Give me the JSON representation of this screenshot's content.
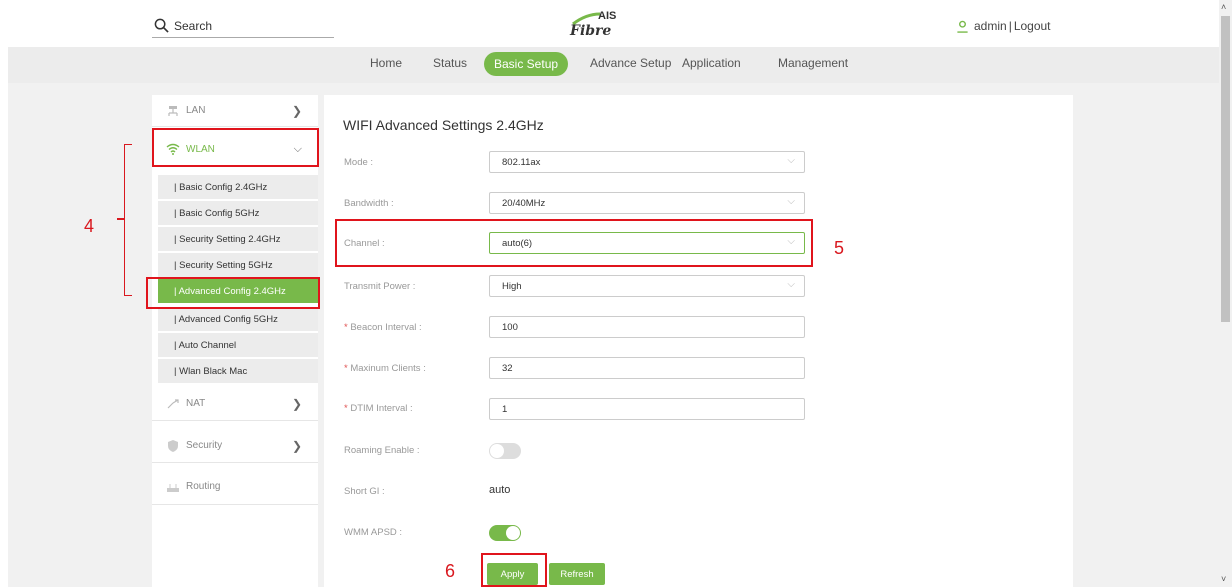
{
  "header": {
    "search_placeholder": "Search",
    "logo_top": "AIS",
    "logo_bottom": "Fibre",
    "user_name": "admin",
    "separator": "|",
    "logout": "Logout"
  },
  "nav": {
    "items": [
      "Home",
      "Status",
      "Basic Setup",
      "Advance Setup",
      "Application",
      "Management"
    ],
    "active": "Basic Setup"
  },
  "sidebar": {
    "lan": "LAN",
    "wlan": "WLAN",
    "sub_items": [
      "| Basic Config 2.4GHz",
      "| Basic Config 5GHz",
      "| Security Setting 2.4GHz",
      "| Security Setting 5GHz",
      "| Advanced Config 2.4GHz",
      "| Advanced Config 5GHz",
      "| Auto Channel",
      "| Wlan Black Mac"
    ],
    "nat": "NAT",
    "security": "Security",
    "routing": "Routing"
  },
  "panel": {
    "title": "WIFI Advanced Settings 2.4GHz",
    "mode_label": "Mode :",
    "mode_value": "802.11ax",
    "bandwidth_label": "Bandwidth :",
    "bandwidth_value": "20/40MHz",
    "channel_label": "Channel :",
    "channel_value": "auto(6)",
    "power_label": "Transmit Power :",
    "power_value": "High",
    "required_mark": "*",
    "beacon_label": " Beacon Interval :",
    "beacon_value": "100",
    "clients_label": " Maxinum Clients :",
    "clients_value": "32",
    "dtim_label": " DTIM Interval :",
    "dtim_value": "1",
    "roaming_label": "Roaming Enable :",
    "roaming_enabled": false,
    "shortgi_label": "Short GI :",
    "shortgi_value": "auto",
    "wmm_label": "WMM APSD :",
    "wmm_enabled": true,
    "apply": "Apply",
    "refresh": "Refresh"
  },
  "annotations": {
    "step4": "4",
    "step5": "5",
    "step6": "6"
  },
  "colors": {
    "accent": "#78b94a",
    "annotation": "#e0141c"
  }
}
